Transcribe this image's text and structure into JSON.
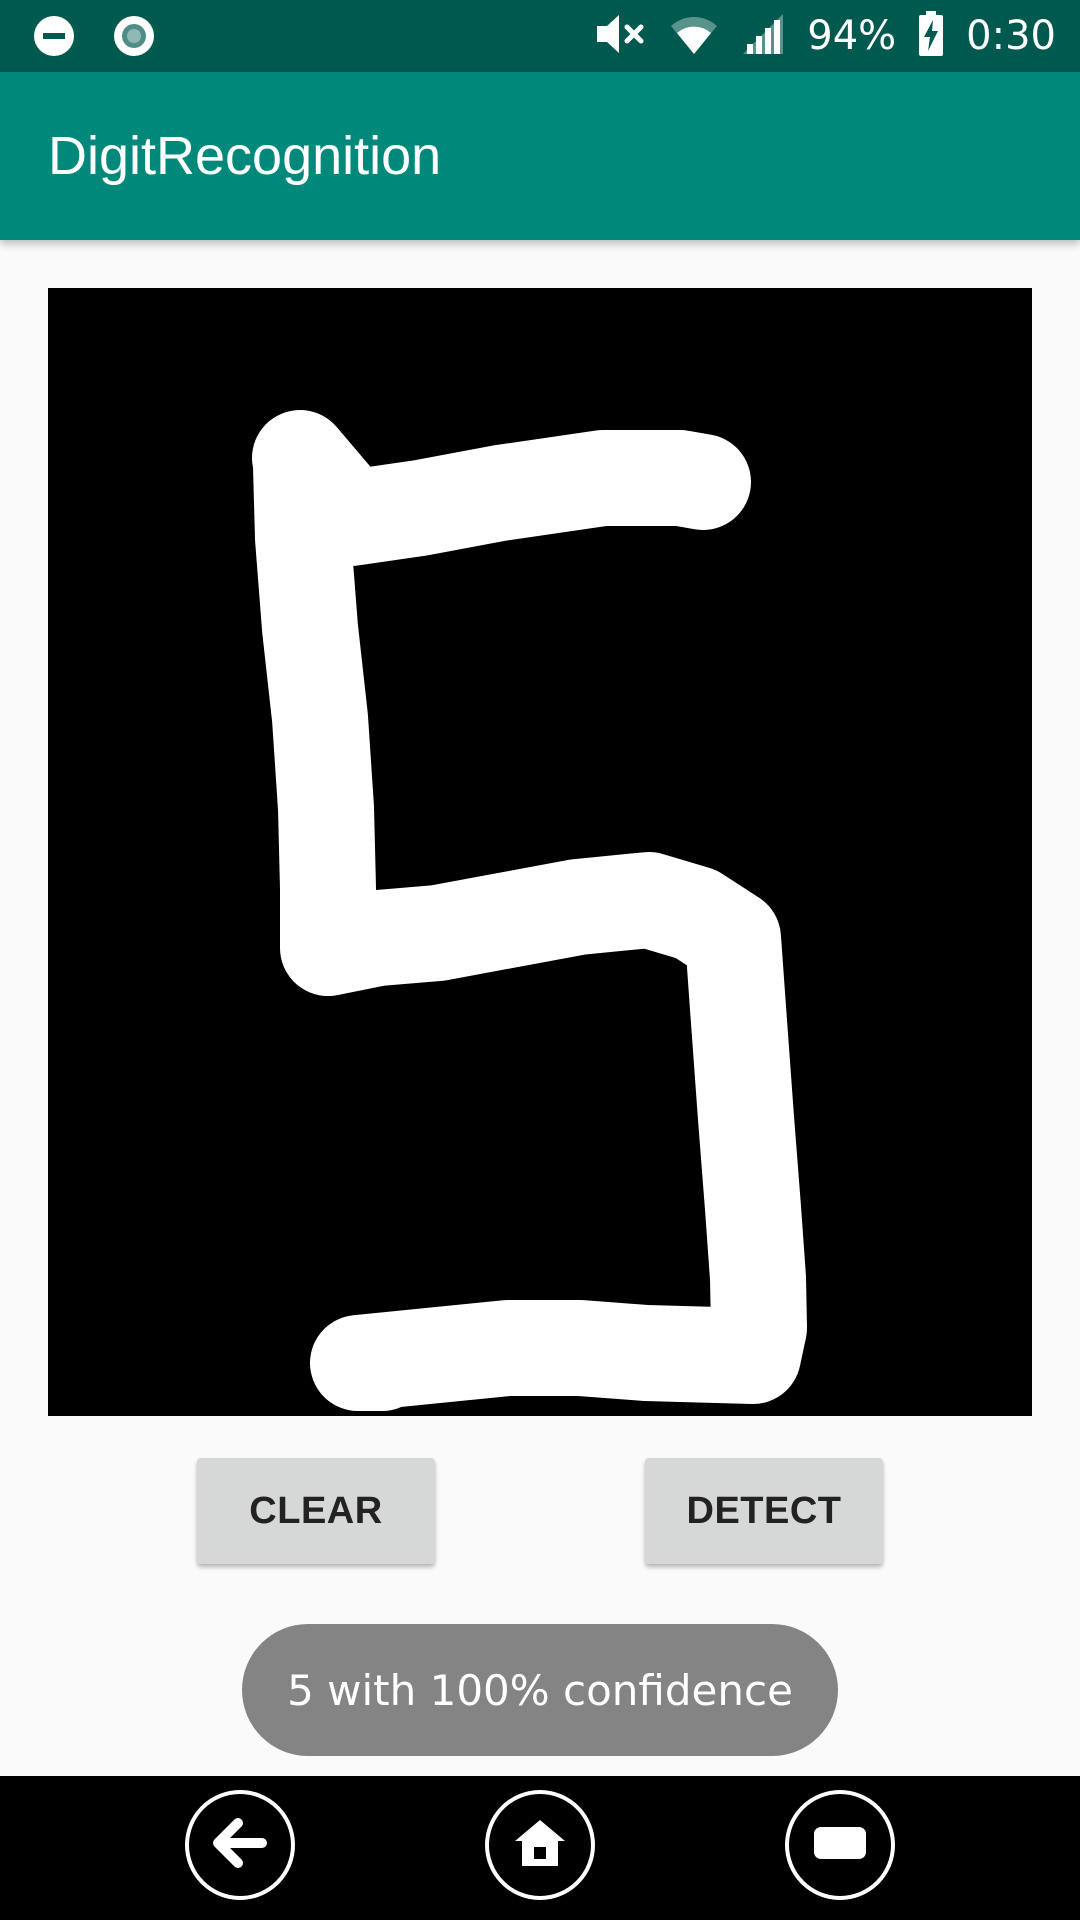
{
  "status_bar": {
    "battery_text": "94%",
    "time": "0:30",
    "icons": [
      "dnd-icon",
      "record-icon",
      "mute-icon",
      "wifi-icon",
      "signal-icon",
      "battery-charging-icon"
    ]
  },
  "app_bar": {
    "title": "DigitRecognition"
  },
  "canvas": {
    "background": "#000000",
    "stroke_color": "#ffffff",
    "drawn_digit_description_icon": "handwritten-stroke"
  },
  "buttons": {
    "clear_label": "CLEAR",
    "detect_label": "DETECT"
  },
  "toast": {
    "message": "5 with 100% confidence"
  },
  "nav_bar": {
    "icons": [
      "back-icon",
      "home-icon",
      "recents-icon"
    ]
  },
  "colors": {
    "status_bar": "#00594f",
    "app_bar": "#00897b",
    "button": "#d6d7d7",
    "toast": "#848484"
  }
}
